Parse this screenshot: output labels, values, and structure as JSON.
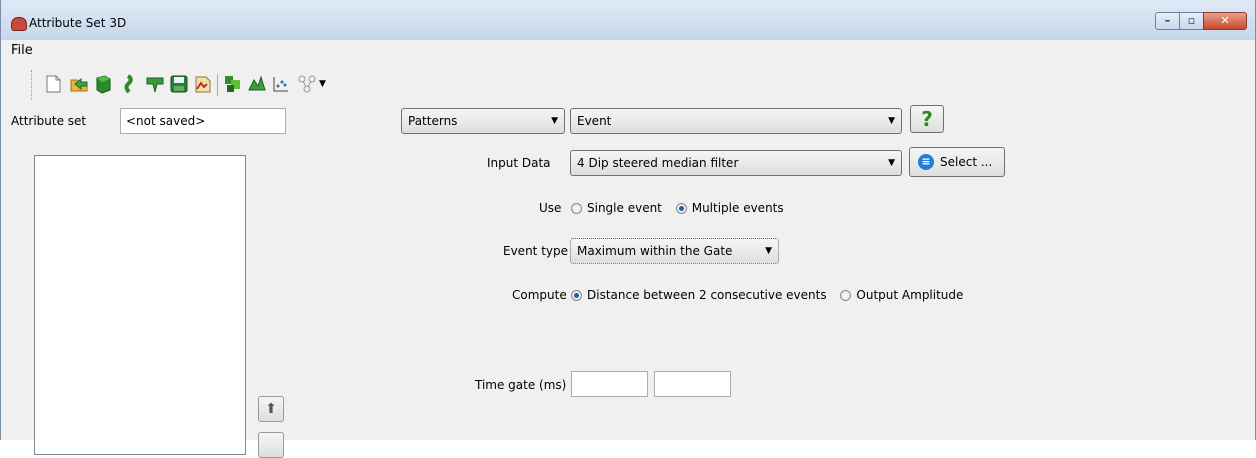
{
  "window": {
    "title": "Attribute Set 3D"
  },
  "menu": {
    "file": "File"
  },
  "toolbar": {
    "icons": [
      "new-icon",
      "open-icon",
      "import-icon",
      "default-set-icon",
      "save-icon",
      "save-as-icon",
      "auto-load-icon",
      "evaluate-icon",
      "crossplot-icon",
      "graph-icon",
      "tree-icon"
    ]
  },
  "attribute_set": {
    "label": "Attribute set",
    "value": "<not saved>"
  },
  "category_combo": {
    "value": "Patterns"
  },
  "attribute_combo": {
    "value": "Event"
  },
  "help_button": {
    "label": "?"
  },
  "input_data": {
    "label": "Input Data",
    "value": "4 Dip steered median filter",
    "select_label": "Select ..."
  },
  "use": {
    "label": "Use",
    "options": [
      {
        "label": "Single event",
        "selected": false
      },
      {
        "label": "Multiple events",
        "selected": true
      }
    ]
  },
  "event_type": {
    "label": "Event type",
    "value": "Maximum within the Gate"
  },
  "compute": {
    "label": "Compute",
    "options": [
      {
        "label": "Distance between 2 consecutive events",
        "selected": true
      },
      {
        "label": "Output Amplitude",
        "selected": false
      }
    ]
  },
  "time_gate": {
    "label": "Time gate (ms)",
    "start": "",
    "stop": ""
  },
  "colors": {
    "title_bar": "#c6d7ec",
    "close_button": "#c8482a",
    "help_green": "#2d8a1e",
    "select_blue": "#1f7fd6",
    "radio_on": "#1c5db0"
  }
}
